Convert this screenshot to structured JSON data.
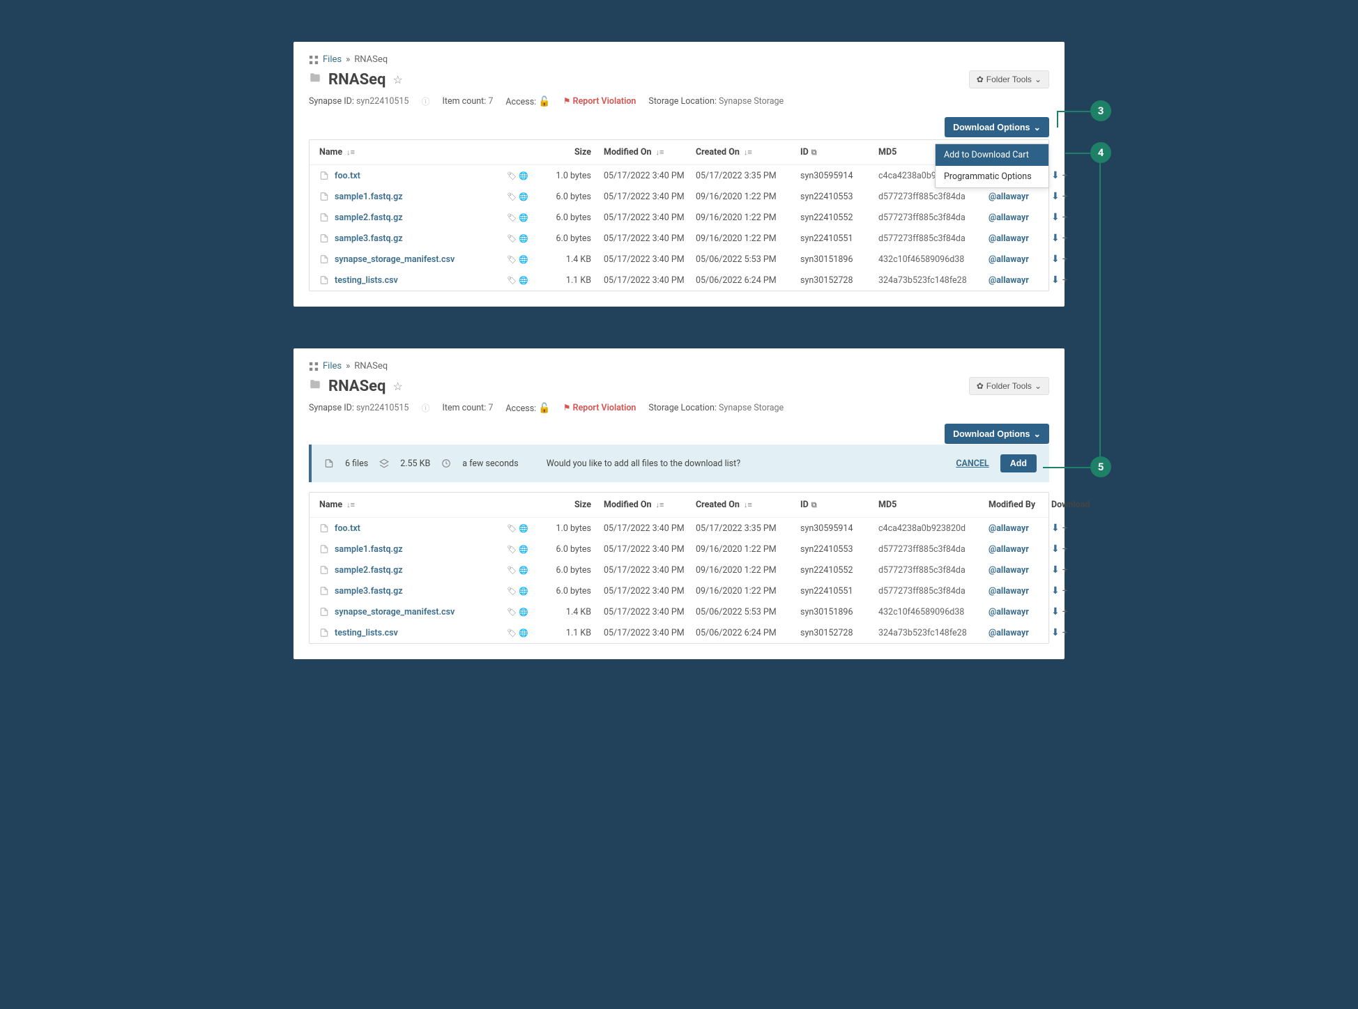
{
  "breadcrumb": {
    "root": "Files",
    "sep": "»",
    "current": "RNASeq"
  },
  "title": "RNASeq",
  "folder_tools_label": "Folder Tools",
  "meta": {
    "synapse_id_lbl": "Synapse ID:",
    "synapse_id": "syn22410515",
    "item_count_lbl": "Item count:",
    "item_count": "7",
    "access_lbl": "Access:",
    "report_label": "Report Violation",
    "storage_lbl": "Storage Location:",
    "storage_val": "Synapse Storage"
  },
  "download_options_label": "Download Options",
  "dropdown": {
    "add_to_cart": "Add to Download Cart",
    "programmatic": "Programmatic Options"
  },
  "columns": {
    "name": "Name",
    "size": "Size",
    "modified": "Modified On",
    "created": "Created On",
    "id": "ID",
    "md5": "MD5",
    "modified_by": "Modified By",
    "download": "Download"
  },
  "columns1_modified_by": "Modifi",
  "files": [
    {
      "name": "foo.txt",
      "size": "1.0 bytes",
      "modified": "05/17/2022 3:40 PM",
      "created": "05/17/2022 3:35 PM",
      "id": "syn30595914",
      "md5": "c4ca4238a0b923820d",
      "user": "@allawayr"
    },
    {
      "name": "sample1.fastq.gz",
      "size": "6.0 bytes",
      "modified": "05/17/2022 3:40 PM",
      "created": "09/16/2020 1:22 PM",
      "id": "syn22410553",
      "md5": "d577273ff885c3f84da",
      "user": "@allawayr"
    },
    {
      "name": "sample2.fastq.gz",
      "size": "6.0 bytes",
      "modified": "05/17/2022 3:40 PM",
      "created": "09/16/2020 1:22 PM",
      "id": "syn22410552",
      "md5": "d577273ff885c3f84da",
      "user": "@allawayr"
    },
    {
      "name": "sample3.fastq.gz",
      "size": "6.0 bytes",
      "modified": "05/17/2022 3:40 PM",
      "created": "09/16/2020 1:22 PM",
      "id": "syn22410551",
      "md5": "d577273ff885c3f84da",
      "user": "@allawayr"
    },
    {
      "name": "synapse_storage_manifest.csv",
      "size": "1.4 KB",
      "modified": "05/17/2022 3:40 PM",
      "created": "05/06/2022 5:53 PM",
      "id": "syn30151896",
      "md5": "432c10f46589096d38",
      "user": "@allawayr"
    },
    {
      "name": "testing_lists.csv",
      "size": "1.1 KB",
      "modified": "05/17/2022 3:40 PM",
      "created": "05/06/2022 6:24 PM",
      "id": "syn30152728",
      "md5": "324a73b523fc148fe28",
      "user": "@allawayr"
    }
  ],
  "confirm": {
    "file_count": "6 files",
    "total_size": "2.55 KB",
    "time_est": "a few seconds",
    "prompt": "Would you like to add all files to the download list?",
    "cancel": "CANCEL",
    "add": "Add"
  },
  "markers": {
    "m3": "3",
    "m4": "4",
    "m5": "5"
  }
}
